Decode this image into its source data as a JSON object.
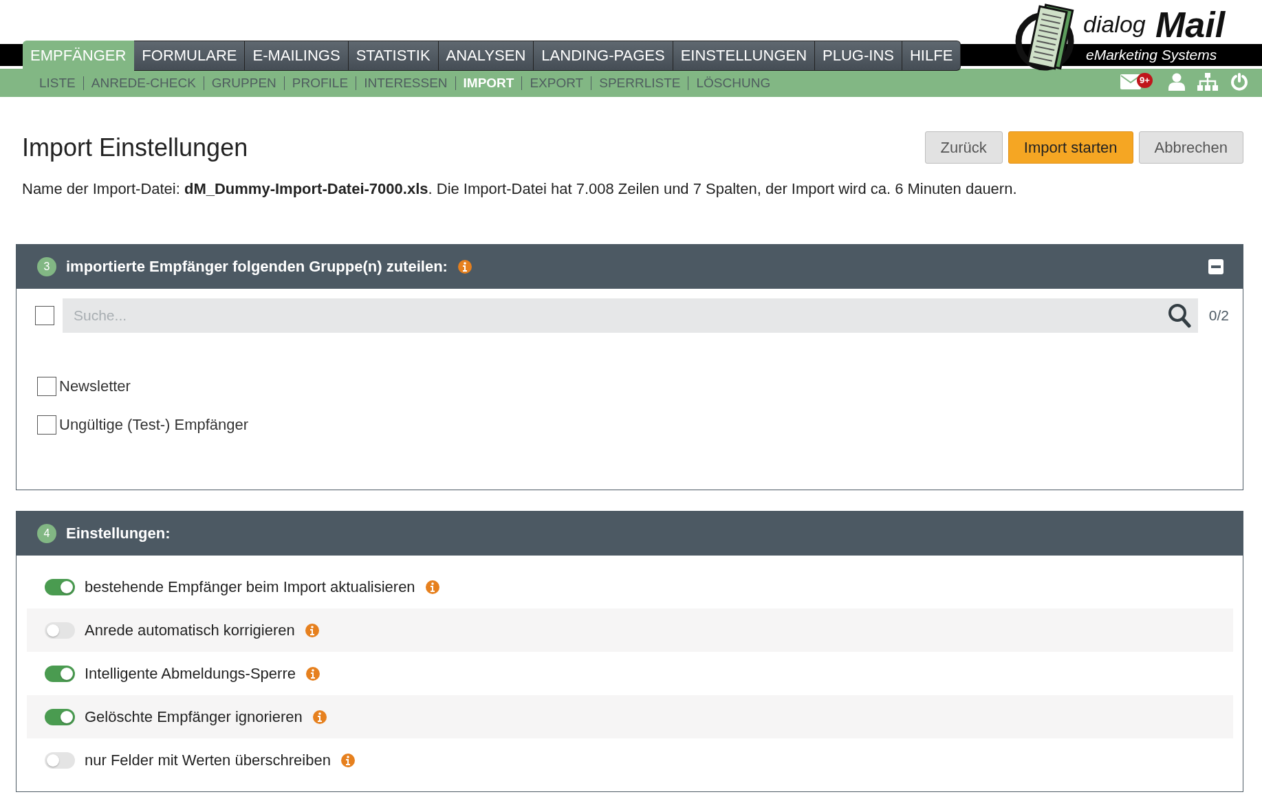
{
  "logo": {
    "word_1": "dialog",
    "word_2": "Mail",
    "tagline": "eMarketing Systems"
  },
  "main_tabs": [
    {
      "label": "EMPFÄNGER",
      "selected": true
    },
    {
      "label": "FORMULARE",
      "selected": false
    },
    {
      "label": "E-MAILINGS",
      "selected": false
    },
    {
      "label": "STATISTIK",
      "selected": false
    },
    {
      "label": "ANALYSEN",
      "selected": false
    },
    {
      "label": "LANDING-PAGES",
      "selected": false
    },
    {
      "label": "EINSTELLUNGEN",
      "selected": false
    },
    {
      "label": "PLUG-INS",
      "selected": false
    },
    {
      "label": "HILFE",
      "selected": false
    }
  ],
  "sub_tabs": [
    {
      "label": "LISTE",
      "selected": false
    },
    {
      "label": "ANREDE-CHECK",
      "selected": false
    },
    {
      "label": "GRUPPEN",
      "selected": false
    },
    {
      "label": "PROFILE",
      "selected": false
    },
    {
      "label": "INTERESSEN",
      "selected": false
    },
    {
      "label": "IMPORT",
      "selected": true
    },
    {
      "label": "EXPORT",
      "selected": false
    },
    {
      "label": "SPERRLISTE",
      "selected": false
    },
    {
      "label": "LÖSCHUNG",
      "selected": false
    }
  ],
  "notifications": {
    "badge": "9+"
  },
  "page": {
    "title": "Import Einstellungen",
    "buttons": [
      {
        "label": "Zurück",
        "kind": "secondary"
      },
      {
        "label": "Import starten",
        "kind": "primary"
      },
      {
        "label": "Abbrechen",
        "kind": "secondary"
      }
    ],
    "info": "Name der Import-Datei: **dM_Dummy-Import-Datei-7000.xls**. Die Import-Datei hat 7.008 Zeilen und 7 Spalten, der Import wird ca. 6 Minuten dauern."
  },
  "groups_panel": {
    "step": "3",
    "title": "importierte Empfänger folgenden Gruppe(n) zuteilen:",
    "select_all": {
      "checked": false
    },
    "search": {
      "placeholder": "Suche..."
    },
    "count": "0/2",
    "items": [
      {
        "label": "Newsletter",
        "checked": false
      },
      {
        "label": "Ungültige (Test-) Empfänger",
        "checked": false
      }
    ]
  },
  "settings_panel": {
    "step": "4",
    "title": "Einstellungen:",
    "options": [
      {
        "label": "bestehende Empfänger beim Import aktualisieren",
        "on": true
      },
      {
        "label": "Anrede automatisch korrigieren",
        "on": false
      },
      {
        "label": "Intelligente Abmeldungs-Sperre",
        "on": true
      },
      {
        "label": "Gelöschte Empfänger ignorieren",
        "on": true
      },
      {
        "label": "nur Felder mit Werten überschreiben",
        "on": false
      }
    ]
  }
}
